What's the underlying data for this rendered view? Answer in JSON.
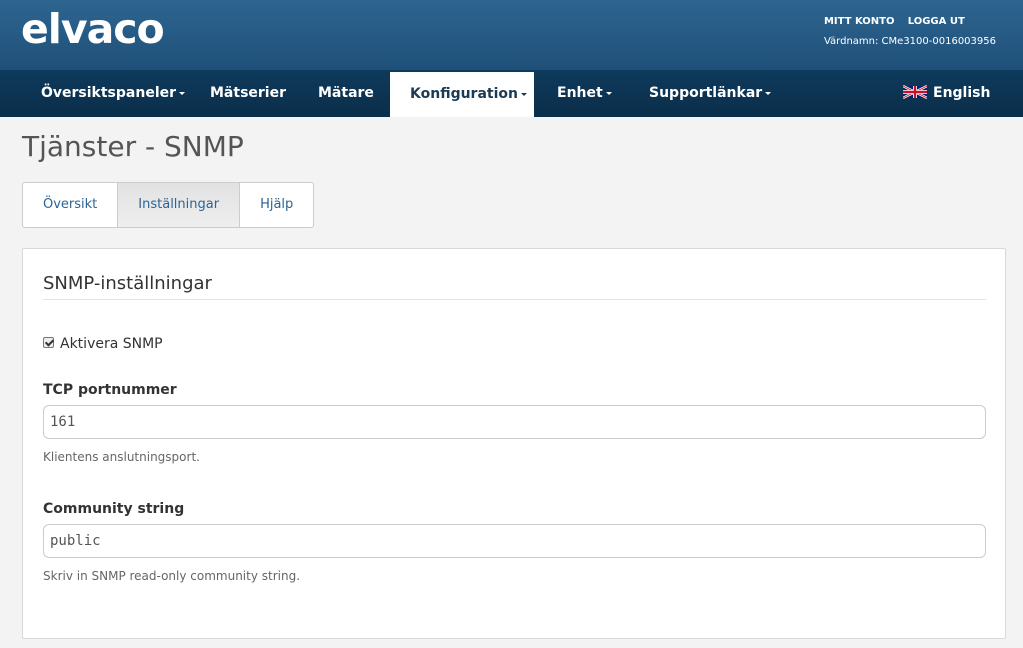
{
  "header": {
    "logo": "elvaco",
    "my_account": "MITT KONTO",
    "logout": "LOGGA UT",
    "hostname": "Värdnamn: CMe3100-0016003956"
  },
  "nav": {
    "items": [
      {
        "label": "Översiktspaneler",
        "dropdown": true
      },
      {
        "label": "Mätserier",
        "dropdown": false
      },
      {
        "label": "Mätare",
        "dropdown": false
      },
      {
        "label": "Konfiguration",
        "dropdown": true,
        "active": true
      },
      {
        "label": "Enhet",
        "dropdown": true
      },
      {
        "label": "Supportlänkar",
        "dropdown": true
      }
    ],
    "language": "English"
  },
  "page": {
    "title": "Tjänster - SNMP",
    "tabs": [
      "Översikt",
      "Inställningar",
      "Hjälp"
    ],
    "active_tab": "Inställningar"
  },
  "panel": {
    "title": "SNMP-inställningar",
    "enable_label": "Aktivera SNMP",
    "enable_checked": true,
    "tcp_label": "TCP portnummer",
    "tcp_value": "161",
    "tcp_help": "Klientens anslutningsport.",
    "community_label": "Community string",
    "community_value": "public",
    "community_help": "Skriv in SNMP read-only community string."
  },
  "colors": {
    "header_bg": "#245a84",
    "navbar_bg": "#0c3452",
    "link": "#2a6496"
  }
}
